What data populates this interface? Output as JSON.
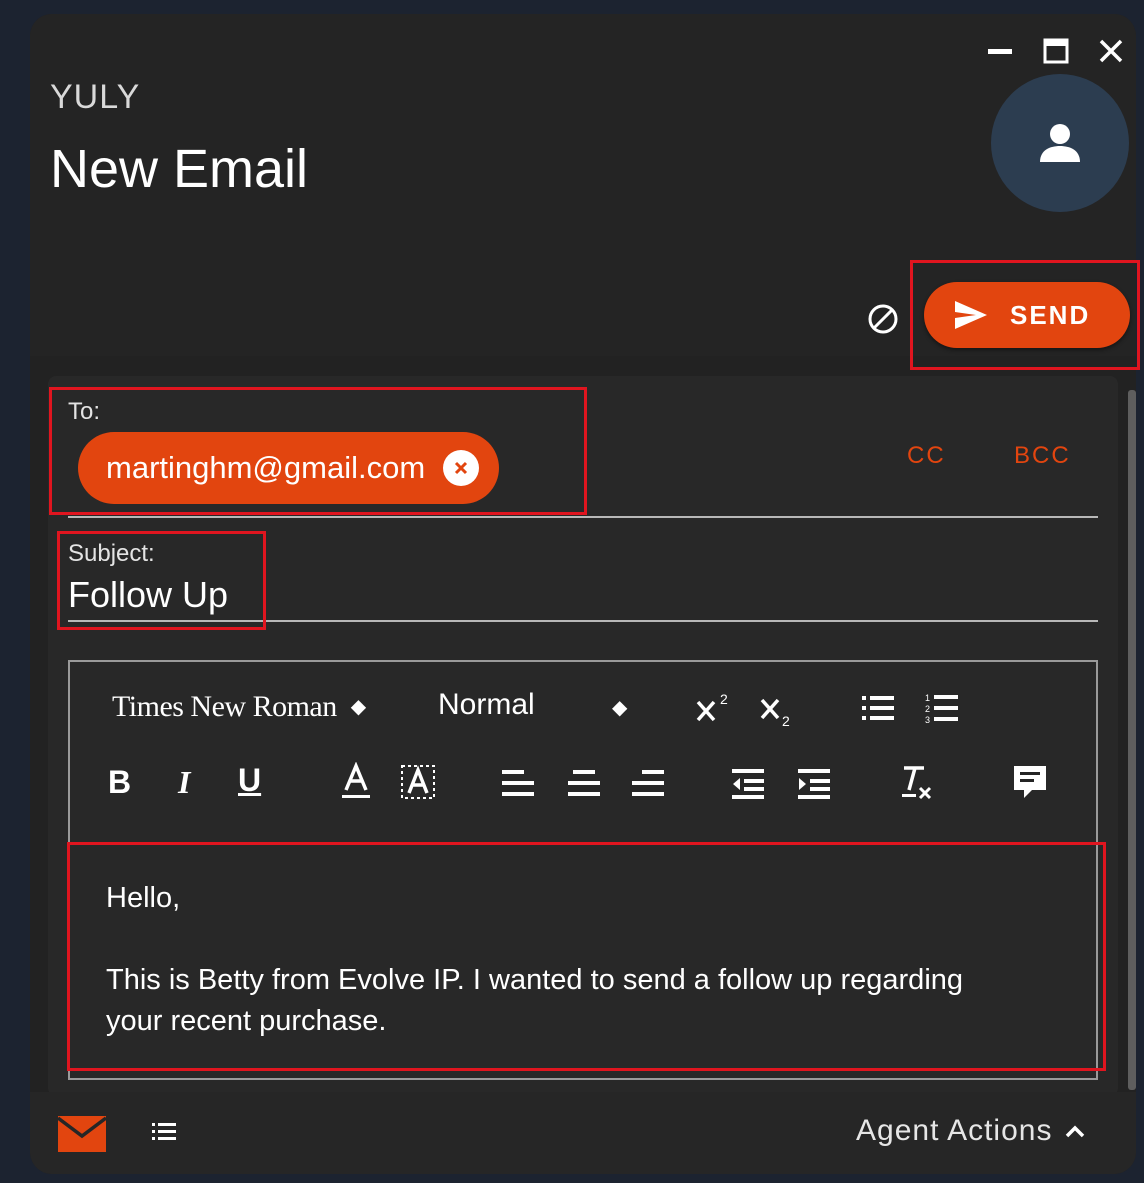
{
  "app": {
    "org_name": "YULY",
    "title": "New Email"
  },
  "window_controls": {
    "minimize_icon": "minimize-icon",
    "maximize_icon": "maximize-icon",
    "close_icon": "close-icon"
  },
  "header": {
    "avatar_icon": "user-icon",
    "discard_icon": "block-icon",
    "send_label": "SEND",
    "send_icon": "send-icon"
  },
  "compose": {
    "to_label": "To:",
    "recipients": [
      {
        "email": "martinghm@gmail.com"
      }
    ],
    "cc_label": "CC",
    "bcc_label": "BCC",
    "subject_label": "Subject:",
    "subject_value": "Follow Up"
  },
  "editor": {
    "font": "Times New Roman",
    "size": "Normal",
    "superscript": "x²",
    "subscript": "x₂",
    "bold": "B",
    "italic": "I",
    "underline": "U",
    "body_lines": [
      "Hello,",
      "This is Betty from Evolve IP.  I wanted to send a follow up regarding",
      "your recent purchase."
    ]
  },
  "footer": {
    "email_icon": "mail-icon",
    "list_icon": "list-icon",
    "agent_actions_label": "Agent Actions"
  },
  "colors": {
    "accent": "#e2450f",
    "background": "#222222",
    "annotation": "#e0151f"
  }
}
